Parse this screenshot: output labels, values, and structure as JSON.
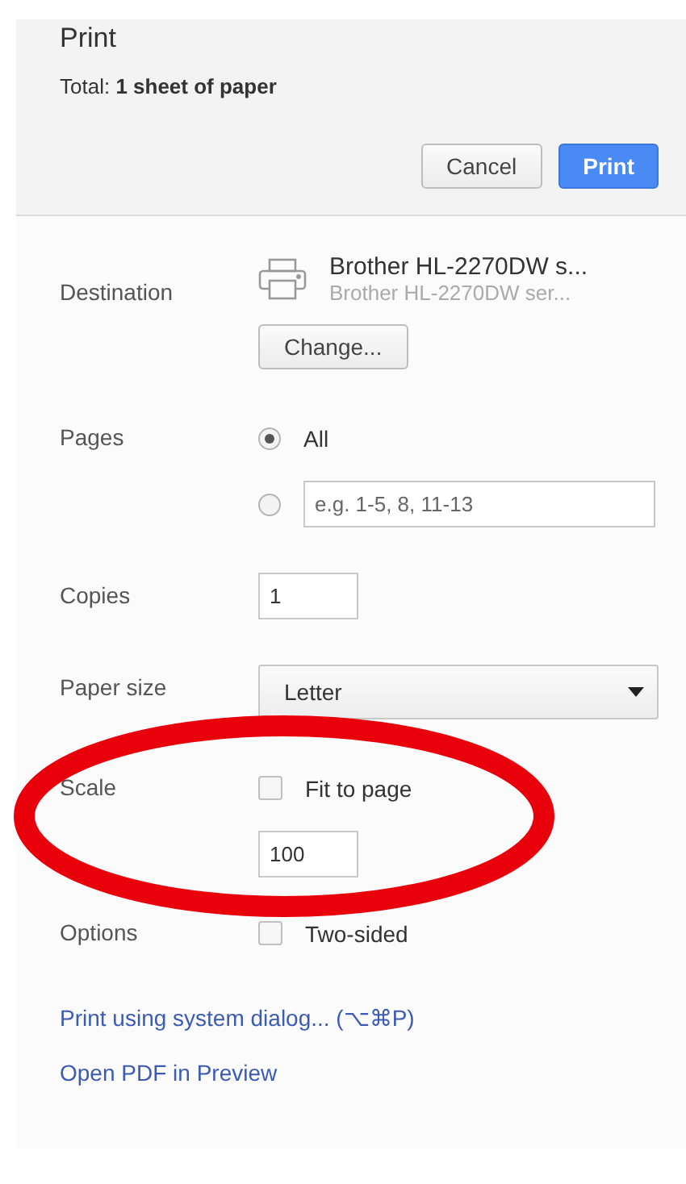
{
  "dialog": {
    "title": "Print",
    "total": "Total: **1 sheet of paper**",
    "buttons": [
      {
        "label": "Cancel",
        "kind": "secondary"
      },
      {
        "label": "Print",
        "kind": "primary"
      }
    ]
  },
  "settings": [
    {
      "label": "Destination",
      "kind": "destination",
      "printer_name": "Brother HL-2270DW s...",
      "printer_detail": "Brother HL-2270DW ser...",
      "button": "Change..."
    },
    {
      "label": "Pages",
      "kind": "radios",
      "options": [
        {
          "kind": "label",
          "text": "All",
          "selected": true
        },
        {
          "kind": "field",
          "placeholder": "e.g. 1-5, 8, 11-13",
          "selected": false
        }
      ]
    },
    {
      "label": "Copies",
      "kind": "number",
      "value": "1"
    },
    {
      "label": "Paper size",
      "kind": "select",
      "value": "Letter"
    },
    {
      "label": "Scale",
      "kind": "checkbox",
      "option": "Fit to page",
      "checked": false,
      "value": "100"
    },
    {
      "label": "Options",
      "kind": "checkbox",
      "option": "Two-sided",
      "checked": false
    }
  ],
  "links": [
    "Print using system dialog... (⌥⌘P)",
    "Open PDF in Preview"
  ],
  "annotation": {
    "kind": "ellipse"
  }
}
